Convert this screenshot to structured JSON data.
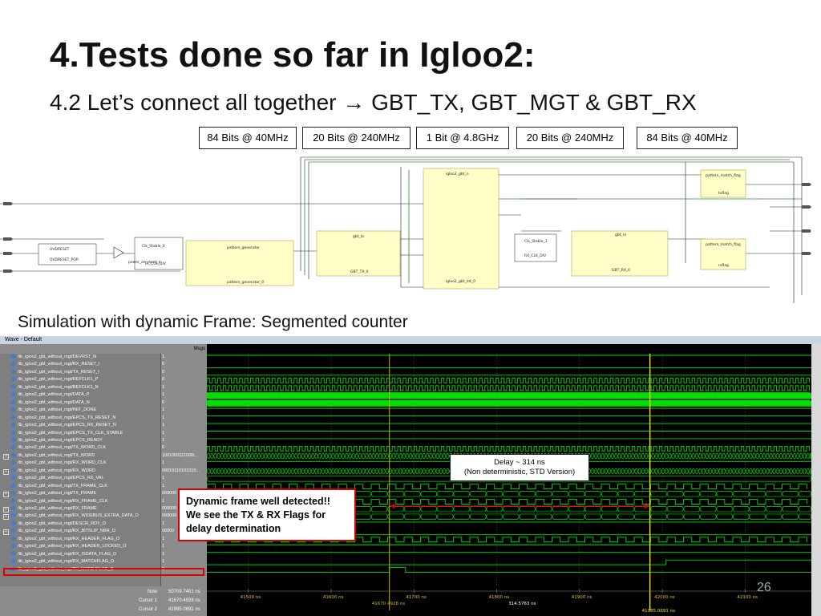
{
  "slide": {
    "title": "4.Tests done so far in Igloo2:",
    "subtitle": "4.2 Let’s connect all together → GBT_TX, GBT_MGT & GBT_RX",
    "page_number": "26",
    "sim_heading": "Simulation with dynamic Frame: Segmented counter"
  },
  "bit_labels": [
    "84 Bits @ 40MHz",
    "20 Bits @ 240MHz",
    "1 Bit @ 4.8GHz",
    "20 Bits @ 240MHz",
    "84 Bits @ 40MHz"
  ],
  "schematic": {
    "blocks": [
      "OVDRESET",
      "OVDRESET_POR",
      "power_on_reset_n",
      "Clk_Stable_0",
      "TX_CLK_DIV",
      "pattern_generator",
      "pattern_generator_0",
      "gbt_tx",
      "GBT_TX_0",
      "igloo2_gbt_n",
      "igloo2_gbt_mt_0",
      "Clk_Stable_1",
      "RX_CLK_DIV",
      "gbt_rx",
      "GBT_RX_0",
      "pattern_match_flag",
      "txflag",
      "pattern_match_flag",
      "rxflag"
    ]
  },
  "wave": {
    "window_title": "Wave - Default",
    "msgs_header": "Msgs",
    "signals": [
      {
        "name": "/tb_igloo2_gbt_without_mgt/DEVRST_N",
        "value": "1",
        "expandable": false
      },
      {
        "name": "/tb_igloo2_gbt_without_mgt/RX_RESET_I",
        "value": "0",
        "expandable": false
      },
      {
        "name": "/tb_igloo2_gbt_without_mgt/TX_RESET_I",
        "value": "0",
        "expandable": false
      },
      {
        "name": "/tb_igloo2_gbt_without_mgt/REFCLK1_P",
        "value": "0",
        "expandable": false
      },
      {
        "name": "/tb_igloo2_gbt_without_mgt/REFCLK1_N",
        "value": "1",
        "expandable": false
      },
      {
        "name": "/tb_igloo2_gbt_without_mgt/DATA_P",
        "value": "1",
        "expandable": false
      },
      {
        "name": "/tb_igloo2_gbt_without_mgt/DATA_N",
        "value": "0",
        "expandable": false
      },
      {
        "name": "/tb_igloo2_gbt_without_mgt/INIT_DONE",
        "value": "1",
        "expandable": false
      },
      {
        "name": "/tb_igloo2_gbt_without_mgt/EPCS_TX_RESET_N",
        "value": "1",
        "expandable": false
      },
      {
        "name": "/tb_igloo2_gbt_without_mgt/EPCS_RX_RESET_N",
        "value": "1",
        "expandable": false
      },
      {
        "name": "/tb_igloo2_gbt_without_mgt/EPCS_TX_CLK_STABLE",
        "value": "1",
        "expandable": false
      },
      {
        "name": "/tb_igloo2_gbt_without_mgt/EPCS_READY",
        "value": "1",
        "expandable": false
      },
      {
        "name": "/tb_igloo2_gbt_without_mgt/TX_WORD_CLK",
        "value": "0",
        "expandable": false
      },
      {
        "name": "/tb_igloo2_gbt_without_mgt/TX_WORD",
        "value": "1001000111000l...",
        "expandable": true
      },
      {
        "name": "/tb_igloo2_gbt_without_mgt/RX_WORD_CLK",
        "value": "1",
        "expandable": false
      },
      {
        "name": "/tb_igloo2_gbt_without_mgt/RX_WORD",
        "value": "00010110101010...",
        "expandable": true
      },
      {
        "name": "/tb_igloo2_gbt_without_mgt/EPCS_RX_VAL",
        "value": "1",
        "expandable": false
      },
      {
        "name": "/tb_igloo2_gbt_without_mgt/TX_FRAME_CLK",
        "value": "1",
        "expandable": false
      },
      {
        "name": "/tb_igloo2_gbt_without_mgt/TX_FRAME",
        "value": "000000",
        "expandable": true
      },
      {
        "name": "/tb_igloo2_gbt_without_mgt/RX_FRAME_CLK",
        "value": "1",
        "expandable": false
      },
      {
        "name": "/tb_igloo2_gbt_without_mgt/RX_FRAME",
        "value": "000000",
        "expandable": true
      },
      {
        "name": "/tb_igloo2_gbt_without_mgt/RX_WIDEBUS_EXTRA_DATA_O",
        "value": "000000",
        "expandable": true
      },
      {
        "name": "/tb_igloo2_gbt_without_mgt/DESCR_RDY_O",
        "value": "1",
        "expandable": false
      },
      {
        "name": "/tb_igloo2_gbt_without_mgt/RX_BITSLIP_NBR_O",
        "value": "00000",
        "expandable": true
      },
      {
        "name": "/tb_igloo2_gbt_without_mgt/RX_HEADER_FLAG_O",
        "value": "1",
        "expandable": false
      },
      {
        "name": "/tb_igloo2_gbt_without_mgt/RX_HEADER_LOCKED_O",
        "value": "1",
        "expandable": false
      },
      {
        "name": "/tb_igloo2_gbt_without_mgt/RX_ISDATA_FLAG_O",
        "value": "1",
        "expandable": false
      },
      {
        "name": "/tb_igloo2_gbt_without_mgt/RX_MATCHFLAG_O",
        "value": "1",
        "expandable": false
      },
      {
        "name": "/tb_igloo2_gbt_without_mgt/TX_MATCHFLAG_O",
        "value": "0",
        "expandable": false
      }
    ],
    "bus_cell_text": "0000...",
    "word_cell_text": "00000000000000",
    "now_label": "Now",
    "now_value": "50709.7401 ns",
    "cursor1_label": "Cursor 1",
    "cursor1_value": "41670.4928 ns",
    "cursor2_label": "Cursor 2",
    "cursor2_value": "41985.0691 ns",
    "cursor1_time_ns": 41670.4928,
    "cursor2_time_ns": 41985.0691,
    "cursor_delta": "314.5763 ns",
    "time_ticks": [
      "41500 ns",
      "41600 ns",
      "41700 ns",
      "41800 ns",
      "41900 ns",
      "42000 ns",
      "42100 ns"
    ],
    "time_range_ns": [
      41450,
      42180
    ],
    "colors": {
      "trace": "#00e000",
      "cursor1": "#d4b000",
      "cursor2": "#f2e200",
      "grid": "#2c6d2c",
      "arrow": "#e00000"
    }
  },
  "annotations": {
    "red_box": [
      "Dynamic frame well detected!!",
      "We see the TX & RX Flags for",
      "delay determination"
    ],
    "delay_line1": "Delay ~ 314 ns",
    "delay_line2": "(Non deterministic,  STD Version)"
  }
}
